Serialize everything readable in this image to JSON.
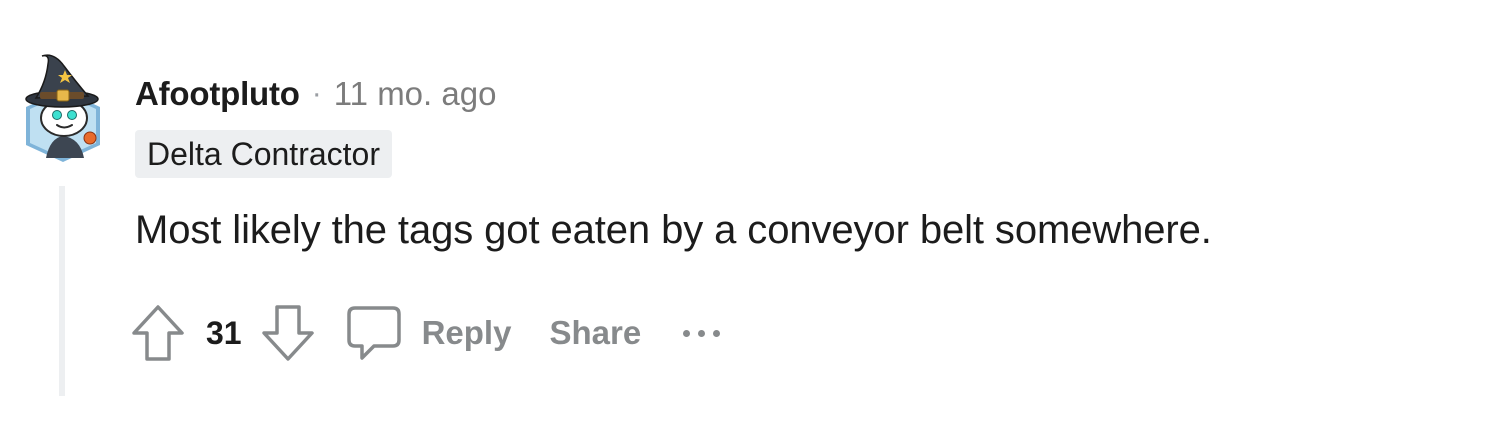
{
  "comment": {
    "author": "Afootpluto",
    "separator": "·",
    "timestamp": "11 mo. ago",
    "flair": "Delta Contractor",
    "body": "Most likely the tags got eaten by a conveyor belt somewhere.",
    "score": "31",
    "avatar": "wizard-snoo-avatar"
  },
  "actions": {
    "upvote_icon": "arrow-up-outline-icon",
    "downvote_icon": "arrow-down-outline-icon",
    "reply_icon": "speech-bubble-icon",
    "reply_label": "Reply",
    "share_label": "Share",
    "more_icon": "ellipsis-icon"
  },
  "colors": {
    "text_primary": "#1c1c1c",
    "text_muted": "#878a8c",
    "flair_bg": "#edeff1",
    "thread_line": "#edeff1"
  }
}
